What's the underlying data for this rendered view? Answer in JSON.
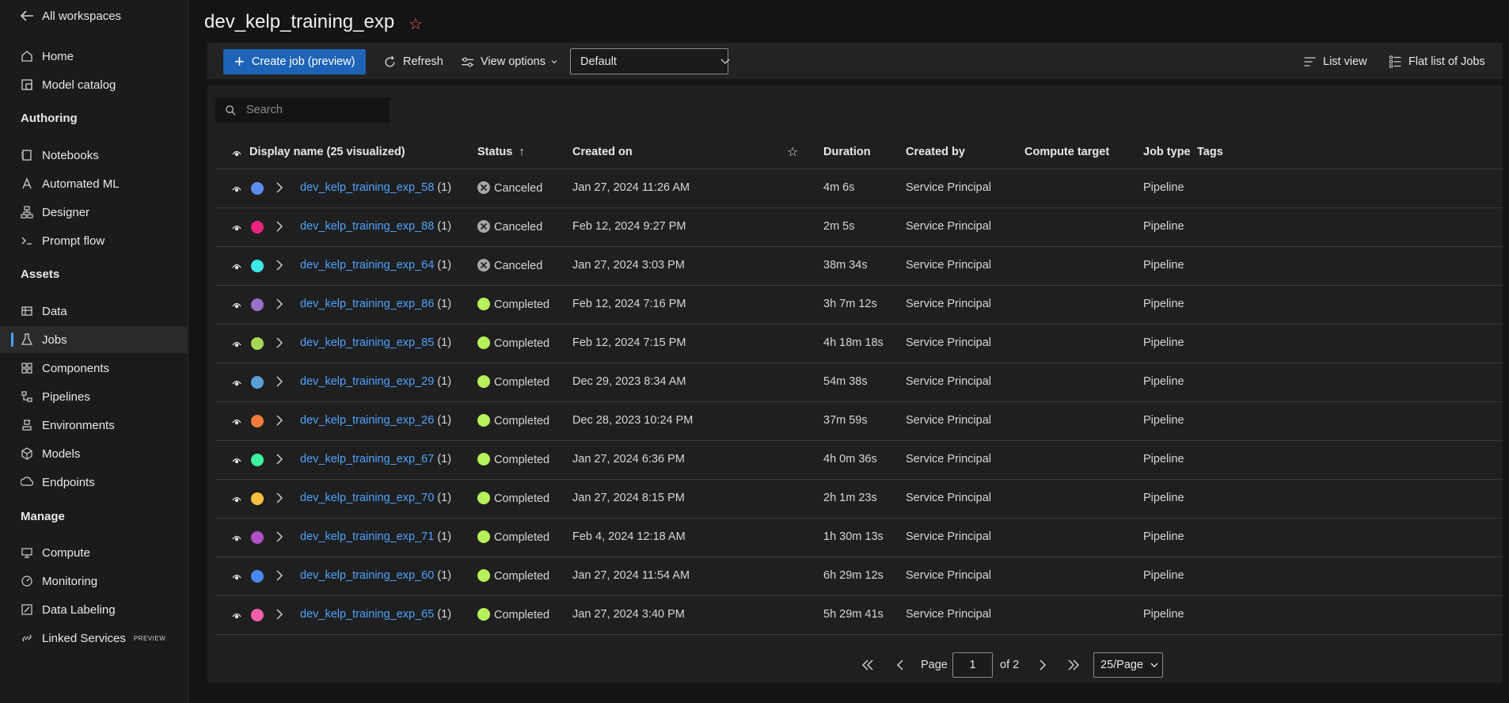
{
  "sidebar": {
    "back_label": "All workspaces",
    "items": [
      {
        "label": "Home",
        "icon": "home-icon"
      },
      {
        "label": "Model catalog",
        "icon": "catalog-icon"
      },
      {
        "label": "Notebooks",
        "icon": "notebook-icon"
      },
      {
        "label": "Automated ML",
        "icon": "automl-icon"
      },
      {
        "label": "Designer",
        "icon": "designer-icon"
      },
      {
        "label": "Prompt flow",
        "icon": "prompt-icon"
      },
      {
        "label": "Data",
        "icon": "data-icon"
      },
      {
        "label": "Jobs",
        "icon": "jobs-flask-icon",
        "active": true
      },
      {
        "label": "Components",
        "icon": "components-icon"
      },
      {
        "label": "Pipelines",
        "icon": "pipelines-icon"
      },
      {
        "label": "Environments",
        "icon": "environments-icon"
      },
      {
        "label": "Models",
        "icon": "models-icon"
      },
      {
        "label": "Endpoints",
        "icon": "endpoints-icon"
      },
      {
        "label": "Compute",
        "icon": "compute-icon"
      },
      {
        "label": "Monitoring",
        "icon": "monitoring-icon"
      },
      {
        "label": "Data Labeling",
        "icon": "labeling-icon"
      },
      {
        "label": "Linked Services",
        "icon": "linked-icon",
        "badge": "PREVIEW"
      }
    ],
    "sections": {
      "authoring": "Authoring",
      "assets": "Assets",
      "manage": "Manage"
    }
  },
  "page": {
    "title": "dev_kelp_training_exp"
  },
  "toolbar": {
    "create_label": "Create job (preview)",
    "refresh_label": "Refresh",
    "view_options_label": "View options",
    "view_select_value": "Default",
    "list_view_label": "List view",
    "flat_list_label": "Flat list of Jobs"
  },
  "search": {
    "placeholder": "Search"
  },
  "table": {
    "headers": {
      "display_name": "Display name (25 visualized)",
      "status": "Status",
      "status_sort": "↑",
      "created_on": "Created on",
      "duration": "Duration",
      "created_by": "Created by",
      "compute_target": "Compute target",
      "job_type": "Job type",
      "tags": "Tags"
    },
    "rows": [
      {
        "name": "dev_kelp_training_exp_58",
        "count": "(1)",
        "color": "#5b8def",
        "status": "Canceled",
        "created_on": "Jan 27, 2024 11:26 AM",
        "duration": "4m 6s",
        "created_by": "Service Principal",
        "job_type": "Pipeline"
      },
      {
        "name": "dev_kelp_training_exp_88",
        "count": "(1)",
        "color": "#e8237f",
        "status": "Canceled",
        "created_on": "Feb 12, 2024 9:27 PM",
        "duration": "2m 5s",
        "created_by": "Service Principal",
        "job_type": "Pipeline"
      },
      {
        "name": "dev_kelp_training_exp_64",
        "count": "(1)",
        "color": "#3ee8e8",
        "status": "Canceled",
        "created_on": "Jan 27, 2024 3:03 PM",
        "duration": "38m 34s",
        "created_by": "Service Principal",
        "job_type": "Pipeline"
      },
      {
        "name": "dev_kelp_training_exp_86",
        "count": "(1)",
        "color": "#9a70c8",
        "status": "Completed",
        "created_on": "Feb 12, 2024 7:16 PM",
        "duration": "3h 7m 12s",
        "created_by": "Service Principal",
        "job_type": "Pipeline"
      },
      {
        "name": "dev_kelp_training_exp_85",
        "count": "(1)",
        "color": "#a8d858",
        "status": "Completed",
        "created_on": "Feb 12, 2024 7:15 PM",
        "duration": "4h 18m 18s",
        "created_by": "Service Principal",
        "job_type": "Pipeline"
      },
      {
        "name": "dev_kelp_training_exp_29",
        "count": "(1)",
        "color": "#5aa0d8",
        "status": "Completed",
        "created_on": "Dec 29, 2023 8:34 AM",
        "duration": "54m 38s",
        "created_by": "Service Principal",
        "job_type": "Pipeline"
      },
      {
        "name": "dev_kelp_training_exp_26",
        "count": "(1)",
        "color": "#f07a3a",
        "status": "Completed",
        "created_on": "Dec 28, 2023 10:24 PM",
        "duration": "37m 59s",
        "created_by": "Service Principal",
        "job_type": "Pipeline"
      },
      {
        "name": "dev_kelp_training_exp_67",
        "count": "(1)",
        "color": "#3ef0a0",
        "status": "Completed",
        "created_on": "Jan 27, 2024 6:36 PM",
        "duration": "4h 0m 36s",
        "created_by": "Service Principal",
        "job_type": "Pipeline"
      },
      {
        "name": "dev_kelp_training_exp_70",
        "count": "(1)",
        "color": "#f8c040",
        "status": "Completed",
        "created_on": "Jan 27, 2024 8:15 PM",
        "duration": "2h 1m 23s",
        "created_by": "Service Principal",
        "job_type": "Pipeline"
      },
      {
        "name": "dev_kelp_training_exp_71",
        "count": "(1)",
        "color": "#b050c8",
        "status": "Completed",
        "created_on": "Feb 4, 2024 12:18 AM",
        "duration": "1h 30m 13s",
        "created_by": "Service Principal",
        "job_type": "Pipeline"
      },
      {
        "name": "dev_kelp_training_exp_60",
        "count": "(1)",
        "color": "#4a88f0",
        "status": "Completed",
        "created_on": "Jan 27, 2024 11:54 AM",
        "duration": "6h 29m 12s",
        "created_by": "Service Principal",
        "job_type": "Pipeline"
      },
      {
        "name": "dev_kelp_training_exp_65",
        "count": "(1)",
        "color": "#f060a8",
        "status": "Completed",
        "created_on": "Jan 27, 2024 3:40 PM",
        "duration": "5h 29m 41s",
        "created_by": "Service Principal",
        "job_type": "Pipeline"
      }
    ]
  },
  "pager": {
    "page_label": "Page",
    "page_value": "1",
    "of_label": "of 2",
    "per_page": "25/Page"
  }
}
